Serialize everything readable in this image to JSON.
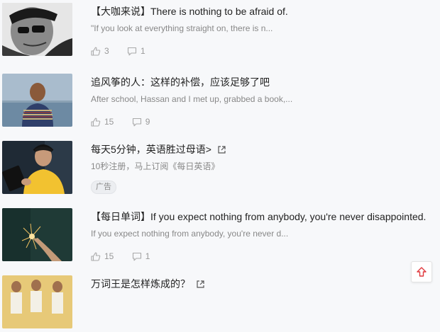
{
  "feed": [
    {
      "type": "article",
      "title": "【大咖来说】There is nothing to be afraid of.",
      "excerpt": "\"If you look at everything straight on, there is n...",
      "likes": "3",
      "comments": "1",
      "thumb_icon": "man-with-sunglasses-photo"
    },
    {
      "type": "article",
      "title": "追风筝的人：这样的补偿，应该足够了吧",
      "excerpt": "After school, Hassan and I met up, grabbed a book,...",
      "likes": "15",
      "comments": "9",
      "thumb_icon": "boy-at-sea-photo"
    },
    {
      "type": "ad",
      "title": "每天5分钟，英语胜过母语>",
      "excerpt": "10秒注册，马上订阅《每日英语》",
      "badge": "广告",
      "thumb_icon": "man-with-headphones-photo"
    },
    {
      "type": "article",
      "title": "【每日单词】If you expect nothing from anybody, you're never disappointed.",
      "excerpt": "If you expect nothing from anybody, you're never d...",
      "likes": "15",
      "comments": "1",
      "thumb_icon": "sparkler-photo"
    },
    {
      "type": "ad",
      "title": "万词王是怎样炼成的？",
      "thumb_icon": "three-people-photo"
    }
  ],
  "icons": {
    "like": "thumbs-up-icon",
    "comment": "comment-icon",
    "external": "external-link-icon",
    "back_to_top": "arrow-up-icon"
  },
  "colors": {
    "background": "#f7f8fa",
    "title": "#222222",
    "excerpt": "#888888",
    "meta": "#999999",
    "accent": "#e0393e"
  }
}
